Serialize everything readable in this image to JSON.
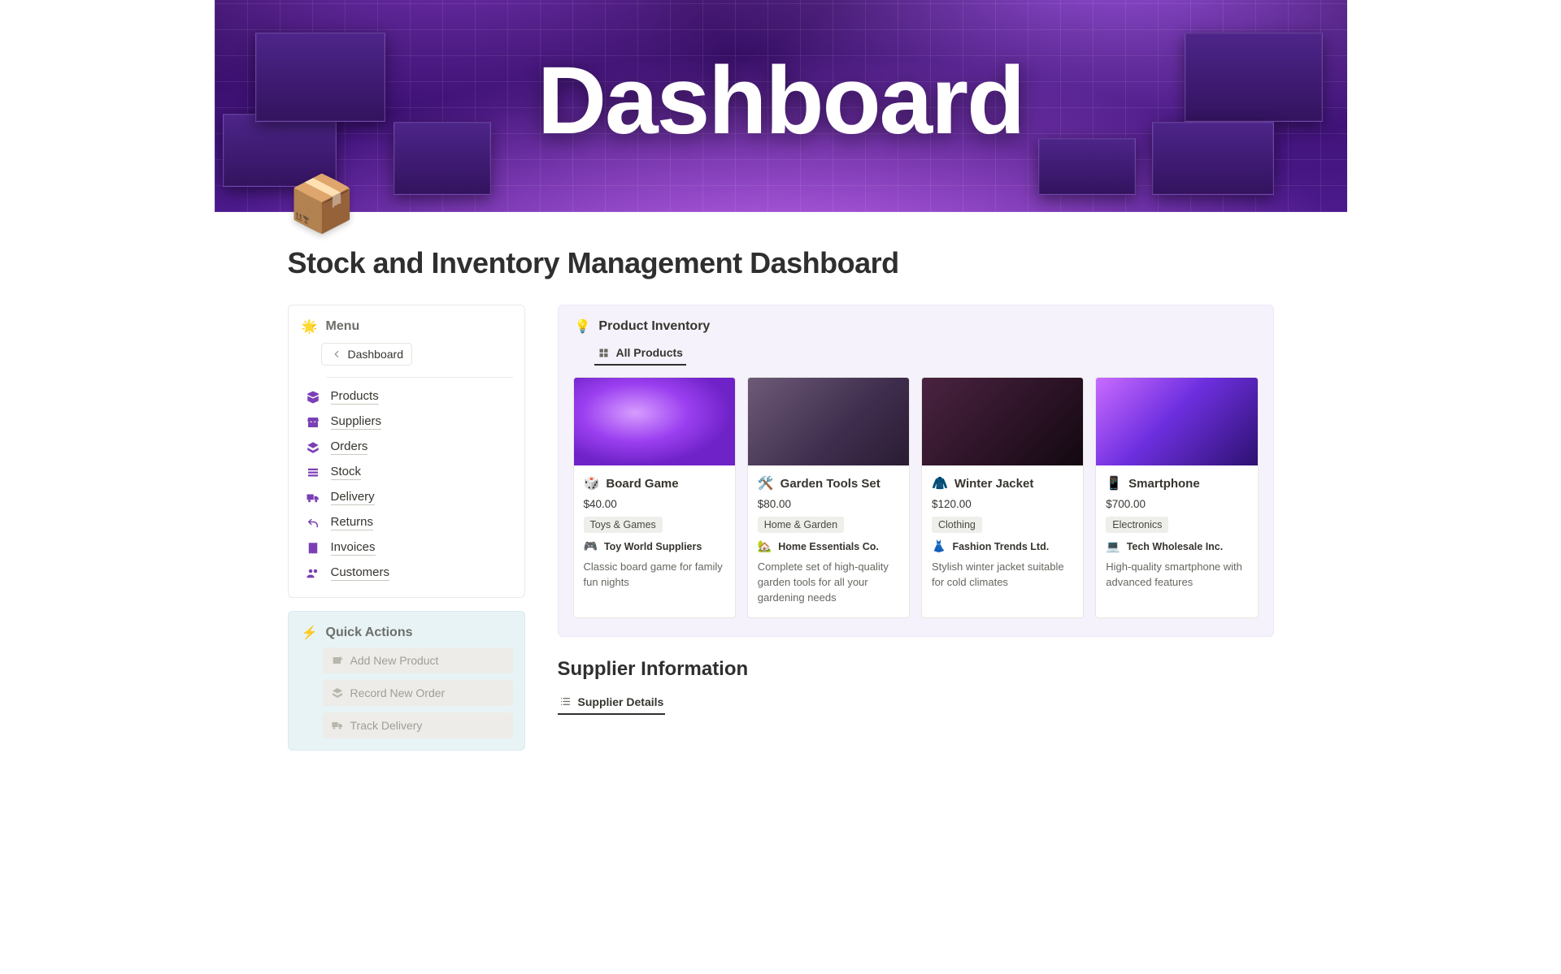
{
  "hero": {
    "title": "Dashboard"
  },
  "page": {
    "icon": "📦",
    "title": "Stock and Inventory Management Dashboard"
  },
  "menu": {
    "heading": "Menu",
    "heading_icon": "🌟",
    "breadcrumb": "Dashboard",
    "items": [
      {
        "id": "products",
        "label": "Products"
      },
      {
        "id": "suppliers",
        "label": "Suppliers"
      },
      {
        "id": "orders",
        "label": "Orders"
      },
      {
        "id": "stock",
        "label": "Stock"
      },
      {
        "id": "delivery",
        "label": "Delivery"
      },
      {
        "id": "returns",
        "label": "Returns"
      },
      {
        "id": "invoices",
        "label": "Invoices"
      },
      {
        "id": "customers",
        "label": "Customers"
      }
    ]
  },
  "quick_actions": {
    "heading": "Quick Actions",
    "heading_icon": "⚡",
    "items": [
      {
        "label": "Add New Product"
      },
      {
        "label": "Record New Order"
      },
      {
        "label": "Track Delivery"
      }
    ]
  },
  "inventory_panel": {
    "heading": "Product Inventory",
    "tab": "All Products",
    "products": [
      {
        "emoji": "🎲",
        "title": "Board Game",
        "price": "$40.00",
        "category": "Toys & Games",
        "supplier_emoji": "🎮",
        "supplier": "Toy World Suppliers",
        "desc": "Classic board game for family fun nights"
      },
      {
        "emoji": "🛠️",
        "title": "Garden Tools Set",
        "price": "$80.00",
        "category": "Home & Garden",
        "supplier_emoji": "🏡",
        "supplier": "Home Essentials Co.",
        "desc": "Complete set of high-quality garden tools for all your gardening needs"
      },
      {
        "emoji": "🧥",
        "title": "Winter Jacket",
        "price": "$120.00",
        "category": "Clothing",
        "supplier_emoji": "👗",
        "supplier": "Fashion Trends Ltd.",
        "desc": "Stylish winter jacket suitable for cold climates"
      },
      {
        "emoji": "📱",
        "title": "Smartphone",
        "price": "$700.00",
        "category": "Electronics",
        "supplier_emoji": "💻",
        "supplier": "Tech Wholesale Inc.",
        "desc": "High-quality smartphone with advanced features"
      }
    ]
  },
  "supplier_section": {
    "heading": "Supplier Information",
    "tab": "Supplier Details"
  },
  "colors": {
    "menu_icon": "#7b3fb5",
    "panel_bg": "#f5f2fb",
    "quick_actions_bg": "#e8f3f6"
  },
  "icons": {
    "products": "box-open-icon",
    "suppliers": "shop-icon",
    "orders": "layers-icon",
    "stock": "stack-icon",
    "delivery": "truck-icon",
    "returns": "undo-icon",
    "invoices": "receipt-icon",
    "customers": "users-icon",
    "grid": "grid-icon",
    "list": "list-icon",
    "qa_add": "box-plus-icon",
    "qa_order": "layers-icon",
    "qa_track": "truck-icon"
  }
}
